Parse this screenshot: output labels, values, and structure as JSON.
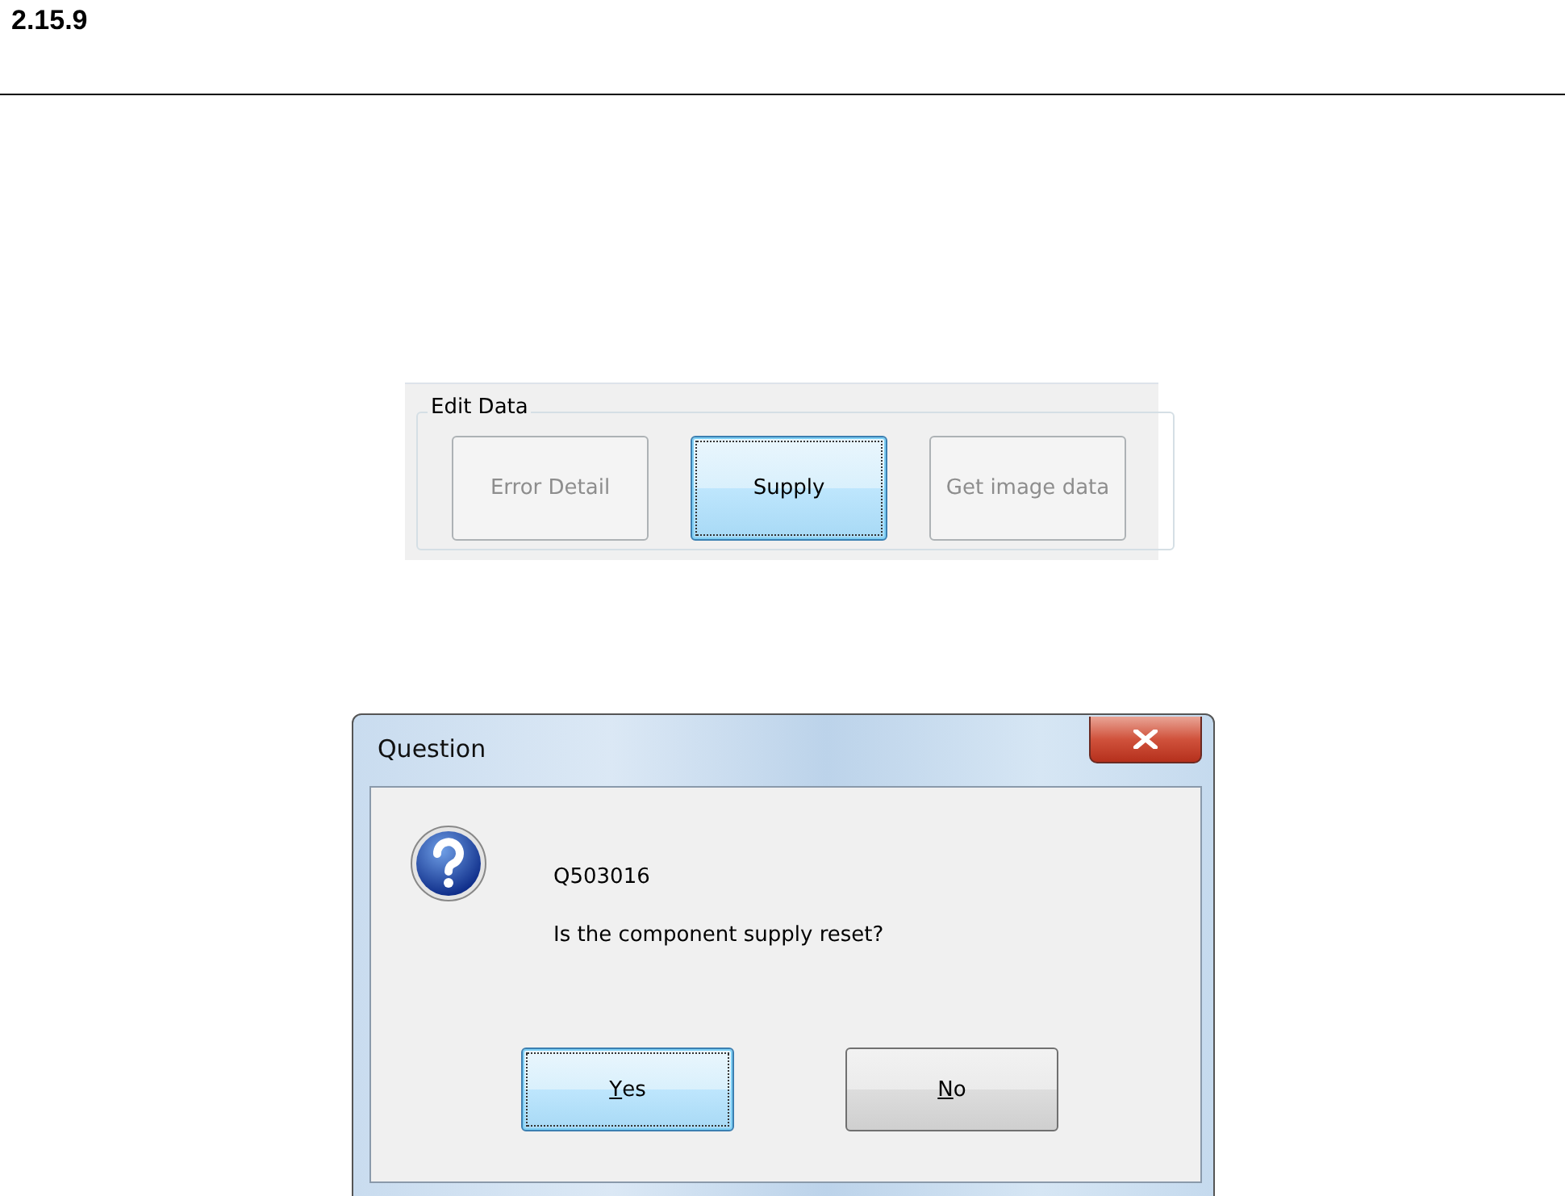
{
  "heading": "2.15.9",
  "edit_panel": {
    "title": "Edit Data",
    "buttons": [
      {
        "label": "Error Detail",
        "disabled": true,
        "focused": false
      },
      {
        "label": "Supply",
        "disabled": false,
        "focused": true
      },
      {
        "label": "Get image data",
        "disabled": true,
        "focused": false
      }
    ]
  },
  "dialog": {
    "title": "Question",
    "code": "Q503016",
    "message": "Is the component supply reset?",
    "buttons": [
      {
        "mnemonic": "Y",
        "rest": "es",
        "focused": true
      },
      {
        "mnemonic": "N",
        "rest": "o",
        "focused": false
      }
    ]
  }
}
